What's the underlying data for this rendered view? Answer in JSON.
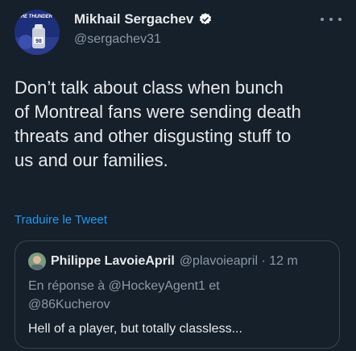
{
  "author": {
    "display_name": "Mikhail Sergachev",
    "handle": "@sergachev31",
    "avatar_text": "THE THUNDER",
    "avatar_number": "98"
  },
  "tweet": {
    "text": "Don’t talk about class when bunch\nof Montreal fans were sending death\nthreats and other disgusting stuff to\nus and our families.",
    "translate_label": "Traduire le Tweet"
  },
  "quoted": {
    "display_name": "Philippe LavoieApril",
    "handle_time": "@plavoieapril · 12 m",
    "reply_line": "En réponse à @HockeyAgent1 et\n@86Kucherov",
    "text": "Hell of a player, but totally classless..."
  },
  "colors": {
    "background": "#15202b",
    "link": "#1d9bf0",
    "muted": "#8b98a5"
  }
}
